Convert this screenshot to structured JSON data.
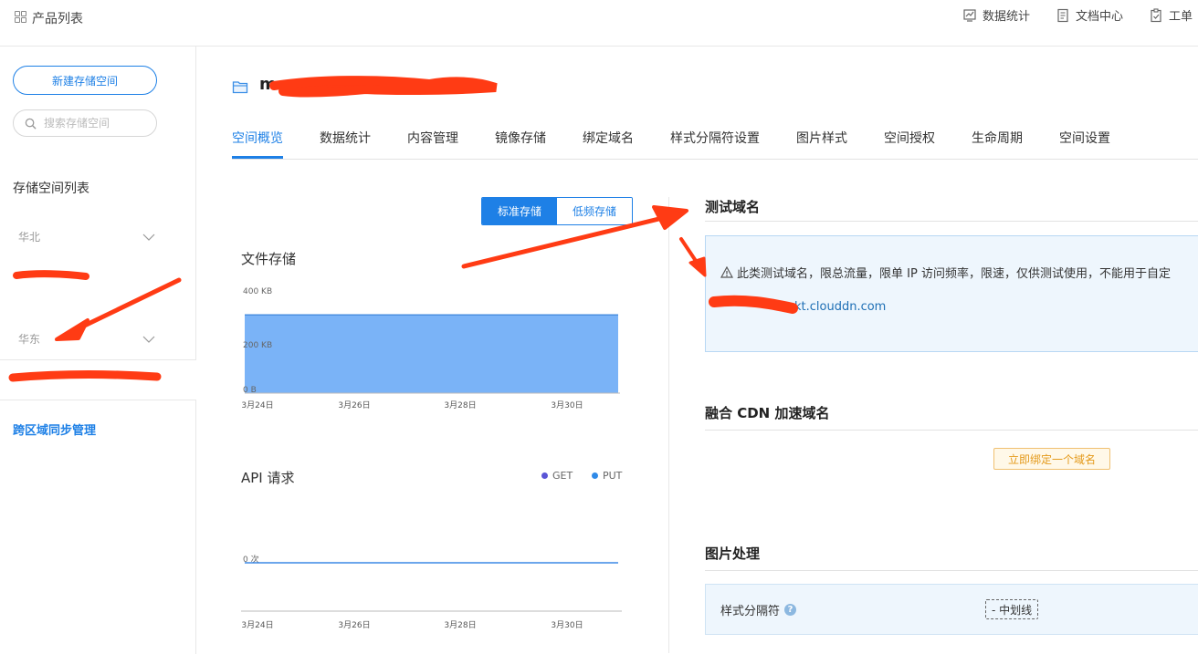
{
  "topbar": {
    "product_list": "产品列表",
    "links": [
      {
        "label": "数据统计",
        "icon": "chart-icon"
      },
      {
        "label": "文档中心",
        "icon": "document-icon"
      },
      {
        "label": "工单",
        "icon": "ticket-icon"
      }
    ]
  },
  "sidebar": {
    "new_bucket_label": "新建存储空间",
    "search_placeholder": "搜索存储空间",
    "list_title": "存储空间列表",
    "regions": [
      {
        "label": "华北"
      },
      {
        "label": "华东"
      }
    ],
    "cross_region": "跨区域同步管理"
  },
  "header": {
    "bucket_name": "m"
  },
  "tabs": [
    {
      "label": "空间概览",
      "active": true
    },
    {
      "label": "数据统计"
    },
    {
      "label": "内容管理"
    },
    {
      "label": "镜像存储"
    },
    {
      "label": "绑定域名"
    },
    {
      "label": "样式分隔符设置"
    },
    {
      "label": "图片样式"
    },
    {
      "label": "空间授权"
    },
    {
      "label": "生命周期"
    },
    {
      "label": "空间设置"
    }
  ],
  "storage_toggle": {
    "standard": "标准存储",
    "low_freq": "低频存储"
  },
  "charts": {
    "file_storage_title": "文件存储",
    "api_title": "API 请求"
  },
  "chart_data": [
    {
      "type": "area",
      "title": "文件存储",
      "x": [
        "3月24日",
        "3月26日",
        "3月28日",
        "3月30日"
      ],
      "y_ticks": [
        "400 KB",
        "200 KB",
        "0 B"
      ],
      "ylim": [
        0,
        400
      ],
      "series": [
        {
          "values": [
            330,
            330,
            330,
            330
          ]
        }
      ],
      "color": "#7ab3f7"
    },
    {
      "type": "line",
      "title": "API 请求",
      "x": [
        "3月24日",
        "3月26日",
        "3月28日",
        "3月30日"
      ],
      "y_ticks": [
        "0 次"
      ],
      "series": [
        {
          "name": "GET",
          "values": [
            0,
            0,
            0,
            0
          ],
          "color": "#5a55d6"
        },
        {
          "name": "PUT",
          "values": [
            0,
            0,
            0,
            0
          ],
          "color": "#2f8ae8"
        }
      ]
    }
  ],
  "test_domain": {
    "title": "测试域名",
    "notice": "此类测试域名，限总流量，限单 IP 访问频率，限速，仅供测试使用，不能用于自定",
    "domain": "kt.clouddn.com"
  },
  "cdn": {
    "title": "融合 CDN 加速域名",
    "bind_label": "立即绑定一个域名"
  },
  "image": {
    "title": "图片处理",
    "separator_label": "样式分隔符",
    "separator_value": "- 中划线"
  },
  "colors": {
    "accent": "#1e80e6",
    "annotation": "#ff3b14"
  }
}
